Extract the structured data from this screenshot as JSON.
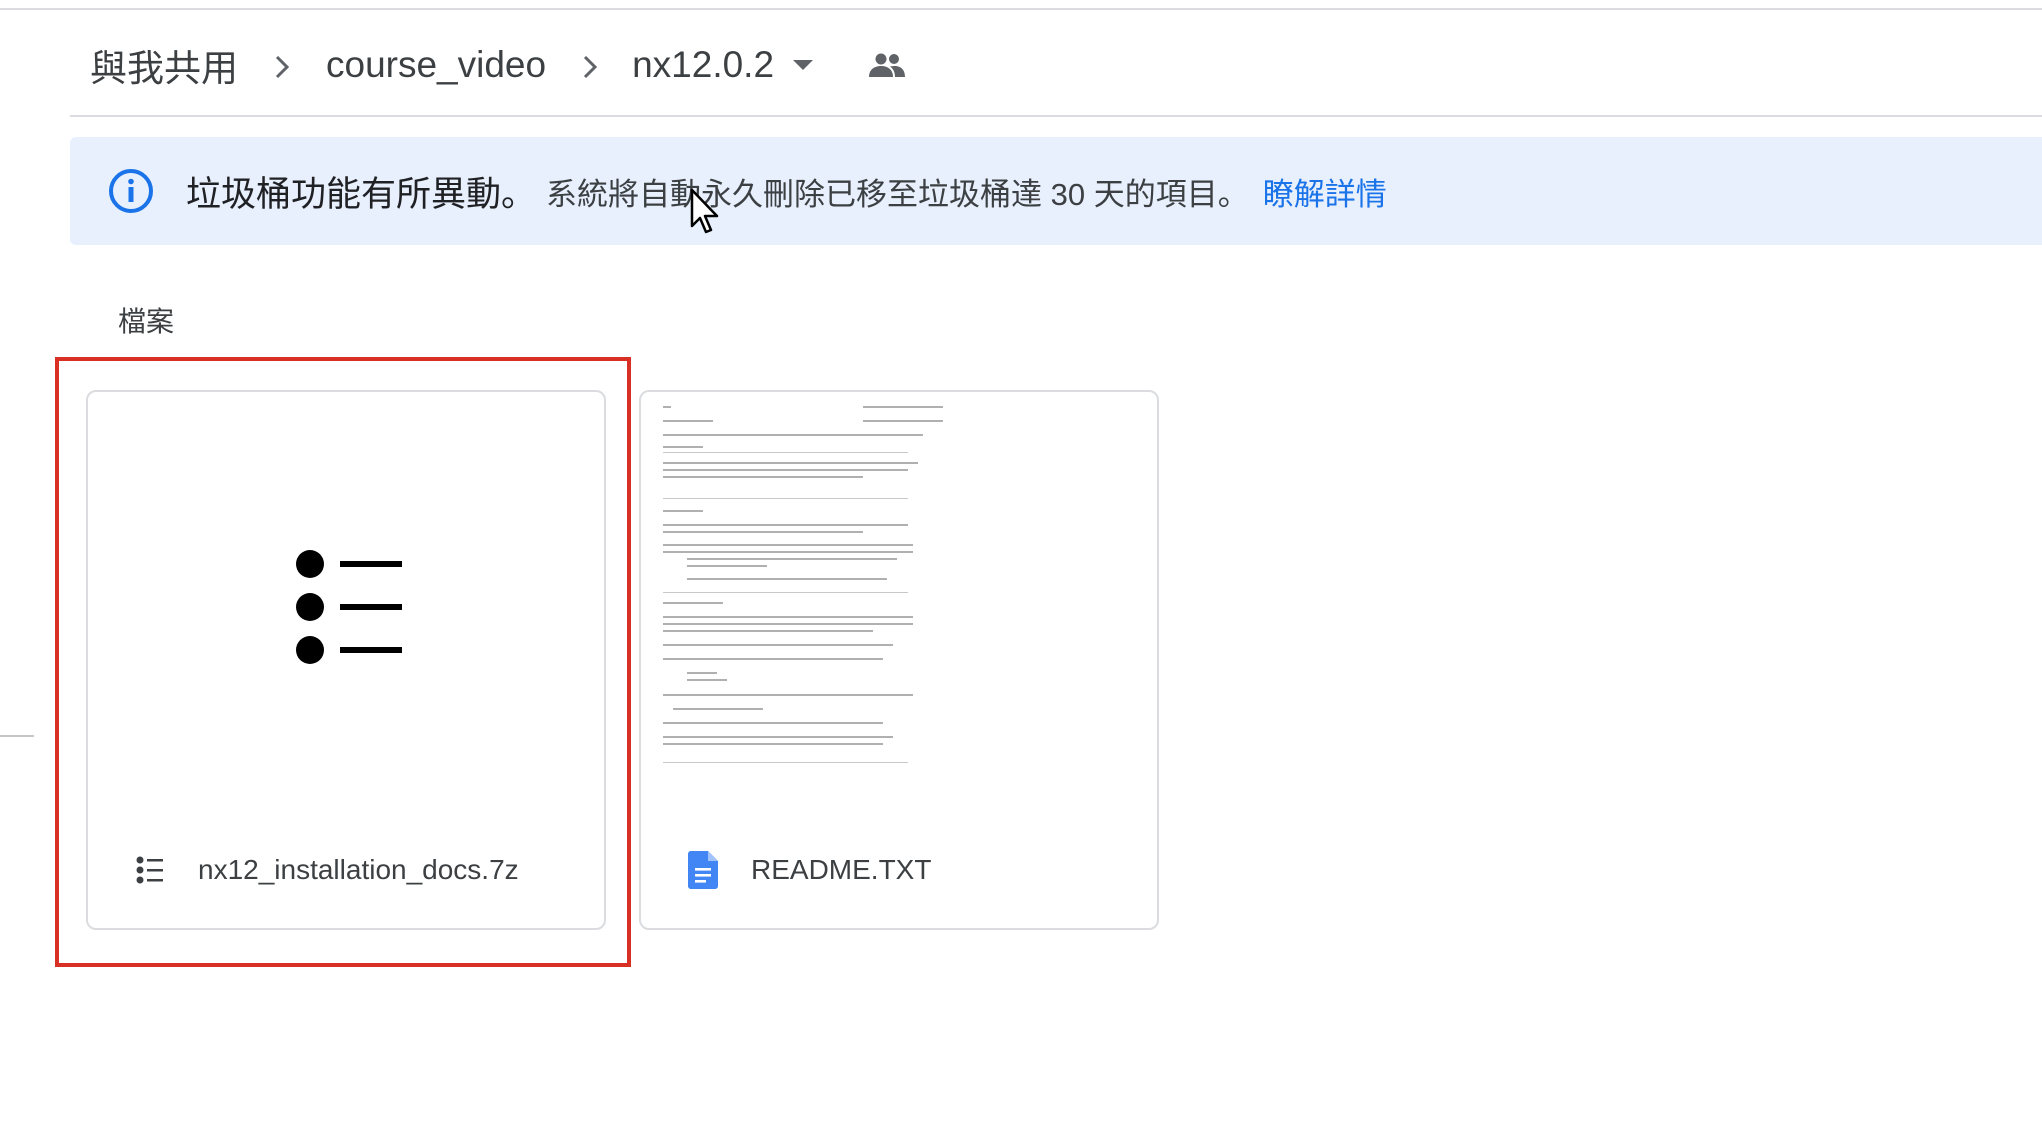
{
  "breadcrumb": {
    "items": [
      "與我共用",
      "course_video",
      "nx12.0.2"
    ],
    "separator_icon": "chevron-right-icon",
    "current_dropdown_icon": "caret-down-icon",
    "shared_icon": "people-icon"
  },
  "banner": {
    "icon": "info-icon",
    "title": "垃圾桶功能有所異動。",
    "message": "系統將自動永久刪除已移至垃圾桶達 30 天的項目。",
    "link": "瞭解詳情"
  },
  "files_section": {
    "label": "檔案",
    "files": [
      {
        "name": "nx12_installation_docs.7z",
        "icon": "archive-list-icon",
        "selected": true
      },
      {
        "name": "README.TXT",
        "icon": "google-docs-icon",
        "selected": false
      }
    ]
  },
  "colors": {
    "banner_bg": "#e8f0fe",
    "link": "#1a73e8",
    "highlight": "#d93025",
    "docs_icon": "#4285f4"
  }
}
